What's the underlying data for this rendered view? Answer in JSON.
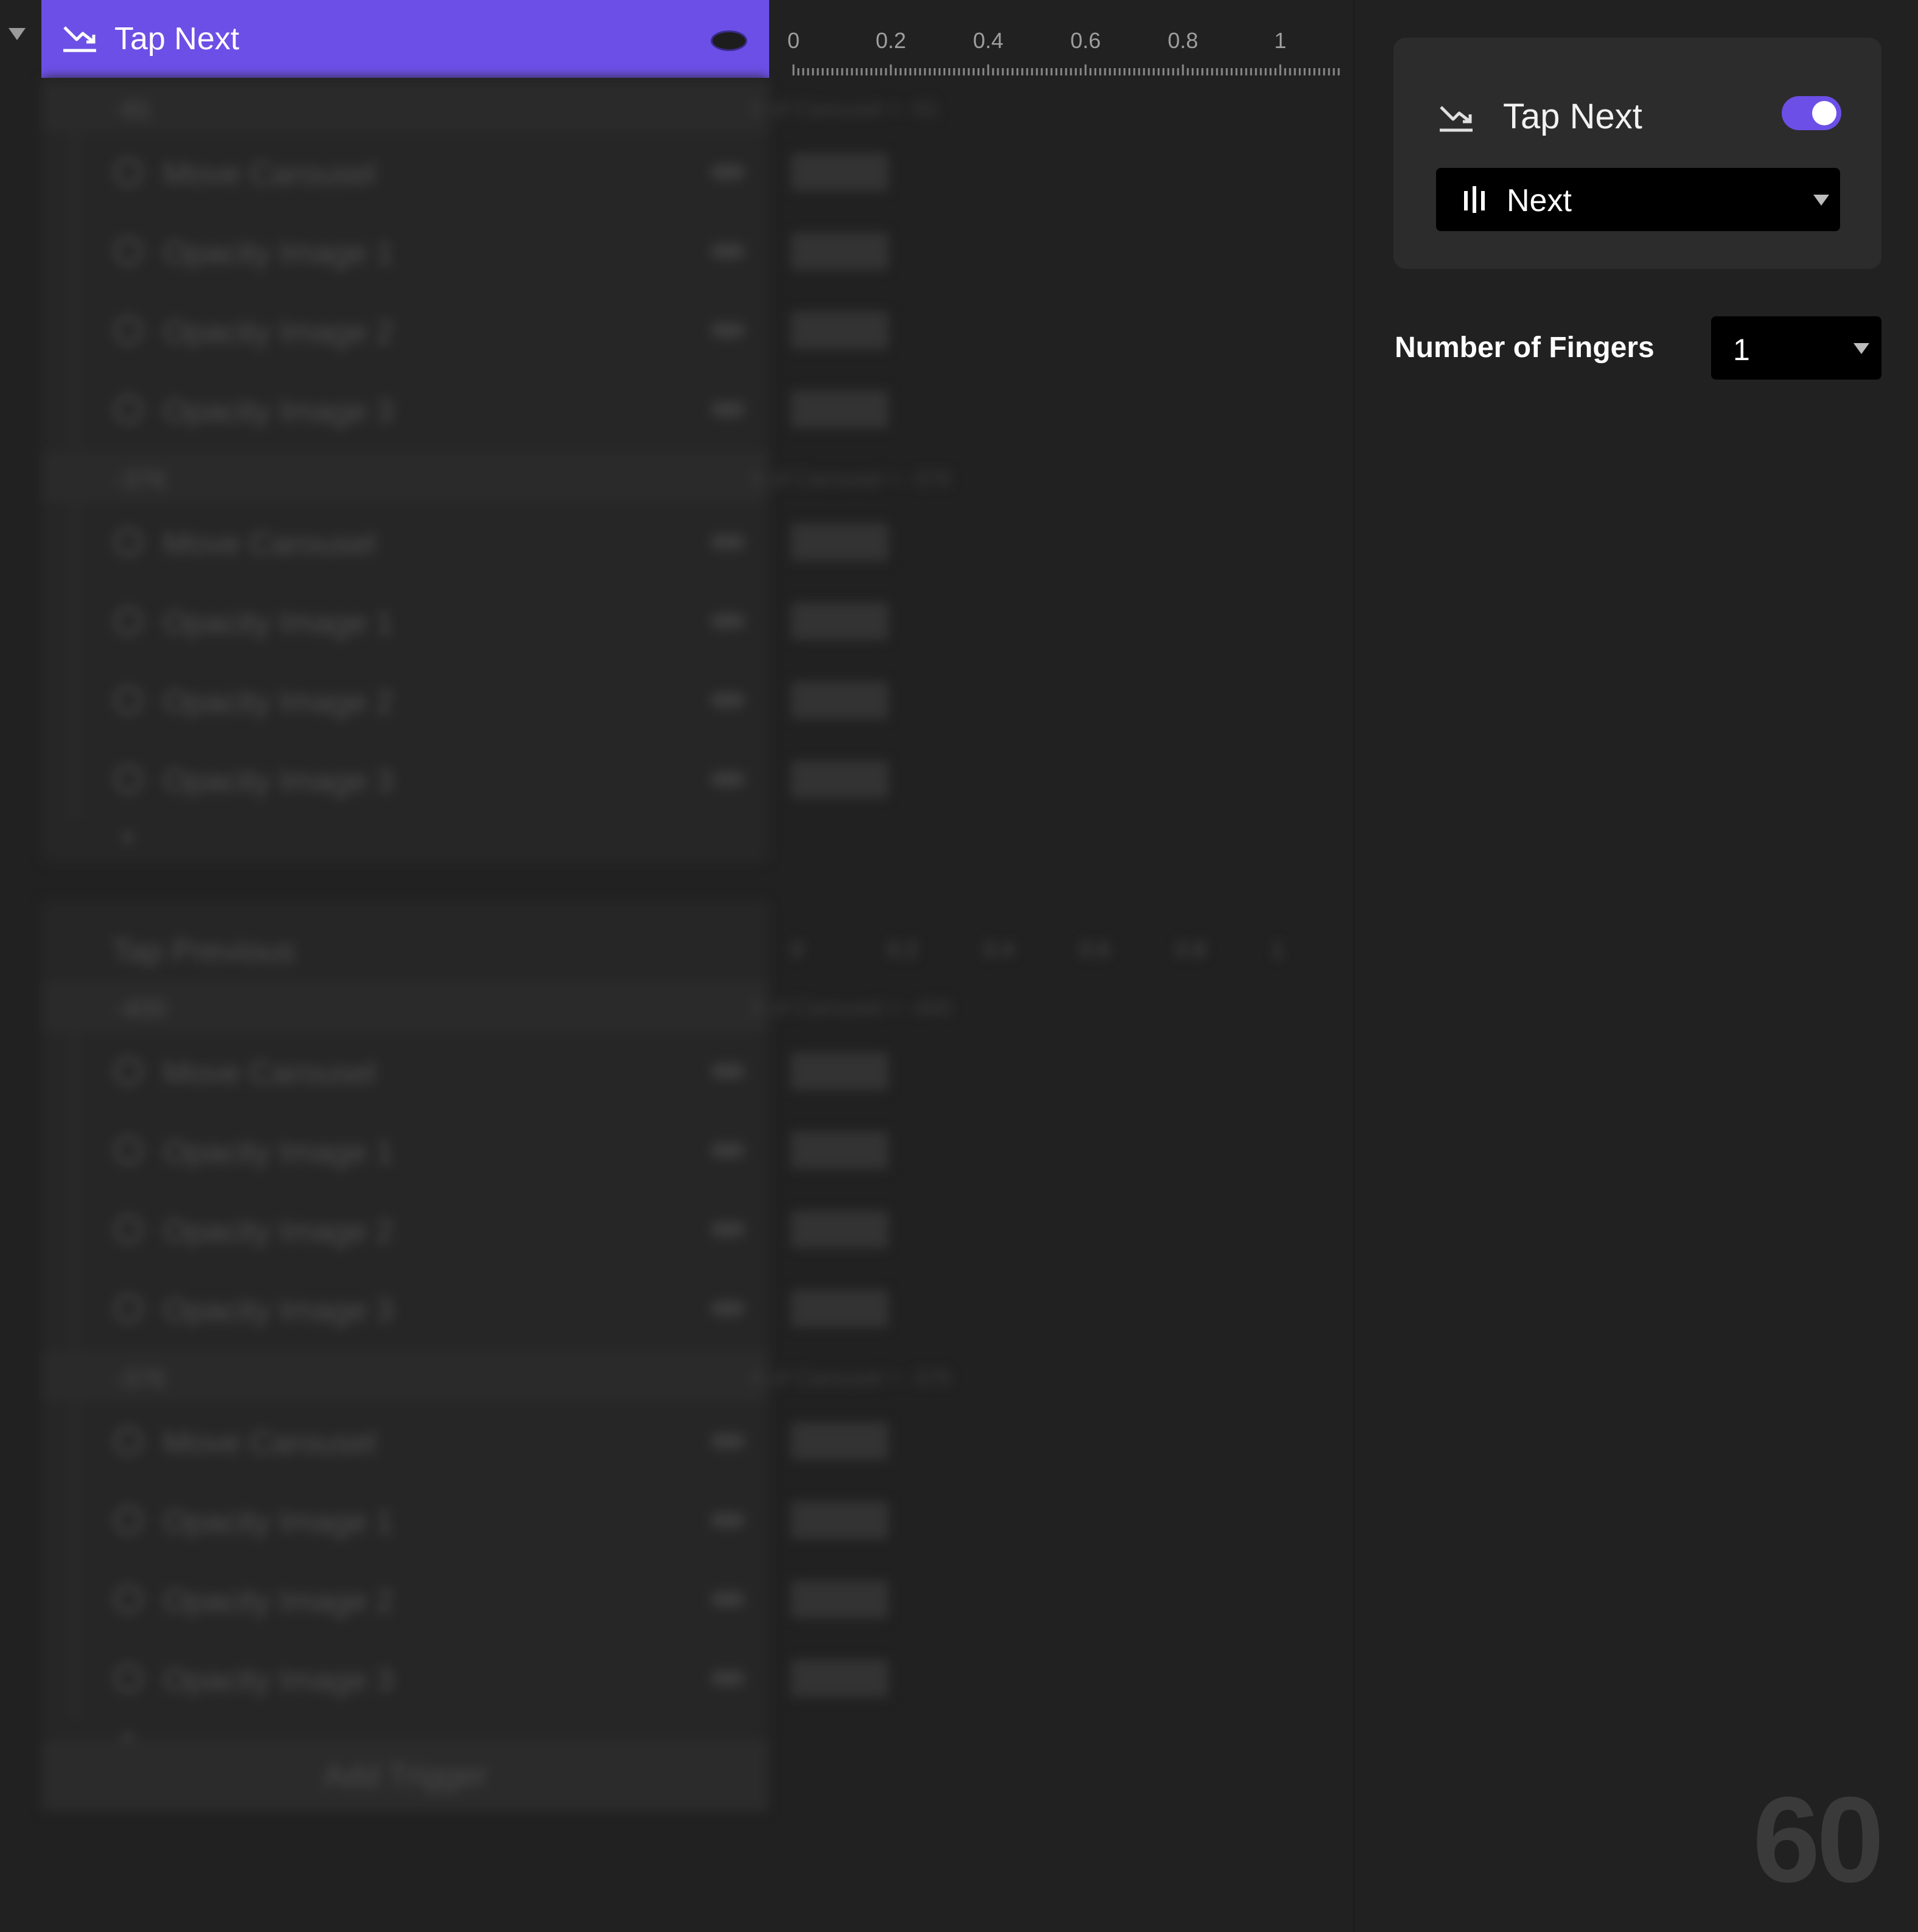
{
  "trigger": {
    "name": "Tap Next",
    "ruler_ticks": [
      "0",
      "0.2",
      "0.4",
      "0.6",
      "0.8",
      "1"
    ]
  },
  "background_list": {
    "groups": [
      {
        "subgroups": [
          {
            "header": "-91",
            "condition": "X of Carousel = -91",
            "rows": [
              "Move Carousel",
              "Opacity Image 1",
              "Opacity Image 2",
              "Opacity Image 3"
            ]
          },
          {
            "header": "-376",
            "condition": "X of Carousel = -376",
            "rows": [
              "Move Carousel",
              "Opacity Image 1",
              "Opacity Image 2",
              "Opacity Image 3"
            ]
          }
        ]
      },
      {
        "title": "Tap Previous",
        "ruler_ticks": [
          "0",
          "0.2",
          "0.4",
          "0.6",
          "0.8",
          "1"
        ],
        "subgroups": [
          {
            "header": "-400",
            "condition": "X of Carousel = -400",
            "rows": [
              "Move Carousel",
              "Opacity Image 1",
              "Opacity Image 2",
              "Opacity Image 3"
            ]
          },
          {
            "header": "-376",
            "condition": "X of Carousel = -376",
            "rows": [
              "Move Carousel",
              "Opacity Image 1",
              "Opacity Image 2",
              "Opacity Image 3"
            ]
          }
        ]
      }
    ],
    "add_trigger_label": "Add Trigger"
  },
  "inspector": {
    "title": "Tap Next",
    "enabled": true,
    "target": "Next",
    "fingers_label": "Number of Fingers",
    "fingers_value": "1"
  },
  "fps": "60",
  "colors": {
    "accent": "#6c4fe6",
    "background": "#212121",
    "card": "#2c2c2c",
    "select": "#000000"
  },
  "icons": {
    "trigger": "tap-trigger-icon",
    "target_layer": "layer-bars-icon"
  }
}
